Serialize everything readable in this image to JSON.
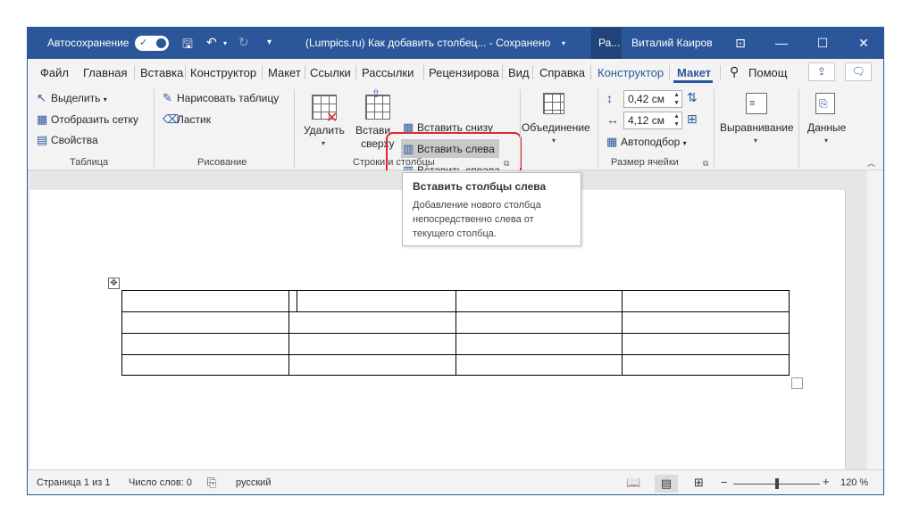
{
  "titlebar": {
    "autosave_label": "Автосохранение",
    "doc_title": "(Lumpics.ru) Как добавить столбец...  -  Сохранено",
    "ra_label": "Ра...",
    "user_name": "Виталий Каиров"
  },
  "tabs": {
    "items": [
      "Файл",
      "Главная",
      "Вставка",
      "Конструктор",
      "Макет",
      "Ссылки",
      "Рассылки",
      "Рецензирова",
      "Вид",
      "Справка"
    ],
    "context_design": "Конструктор",
    "context_layout": "Макет",
    "search": "Помощ"
  },
  "ribbon": {
    "table_group": {
      "select": "Выделить",
      "show_grid": "Отобразить сетку",
      "properties": "Свойства",
      "label": "Таблица"
    },
    "draw_group": {
      "draw_table": "Нарисовать таблицу",
      "eraser": "Ластик",
      "label": "Рисование"
    },
    "rows_cols_group": {
      "delete": "Удалить",
      "insert_above_1": "Встави",
      "insert_above_2": "сверху",
      "insert_below": "Вставить снизу",
      "insert_left": "Вставить слева",
      "insert_right": "Вставить справа",
      "label": "Строки и столбцы"
    },
    "merge_group": {
      "merge": "Объединение"
    },
    "cell_size_group": {
      "height": "0,42 см",
      "width": "4,12 см",
      "autofit": "Автоподбор",
      "label": "Размер ячейки"
    },
    "alignment": "Выравнивание",
    "data": "Данные"
  },
  "tooltip": {
    "title": "Вставить столбцы слева",
    "body_1": "Добавление нового столбца",
    "body_2": "непосредственно слева от",
    "body_3": "текущего столбца."
  },
  "status": {
    "page": "Страница 1 из 1",
    "words": "Число слов: 0",
    "language": "русский",
    "zoom": "120 %"
  },
  "colors": {
    "accent": "#2b579a",
    "highlight_border": "#e0272f"
  }
}
